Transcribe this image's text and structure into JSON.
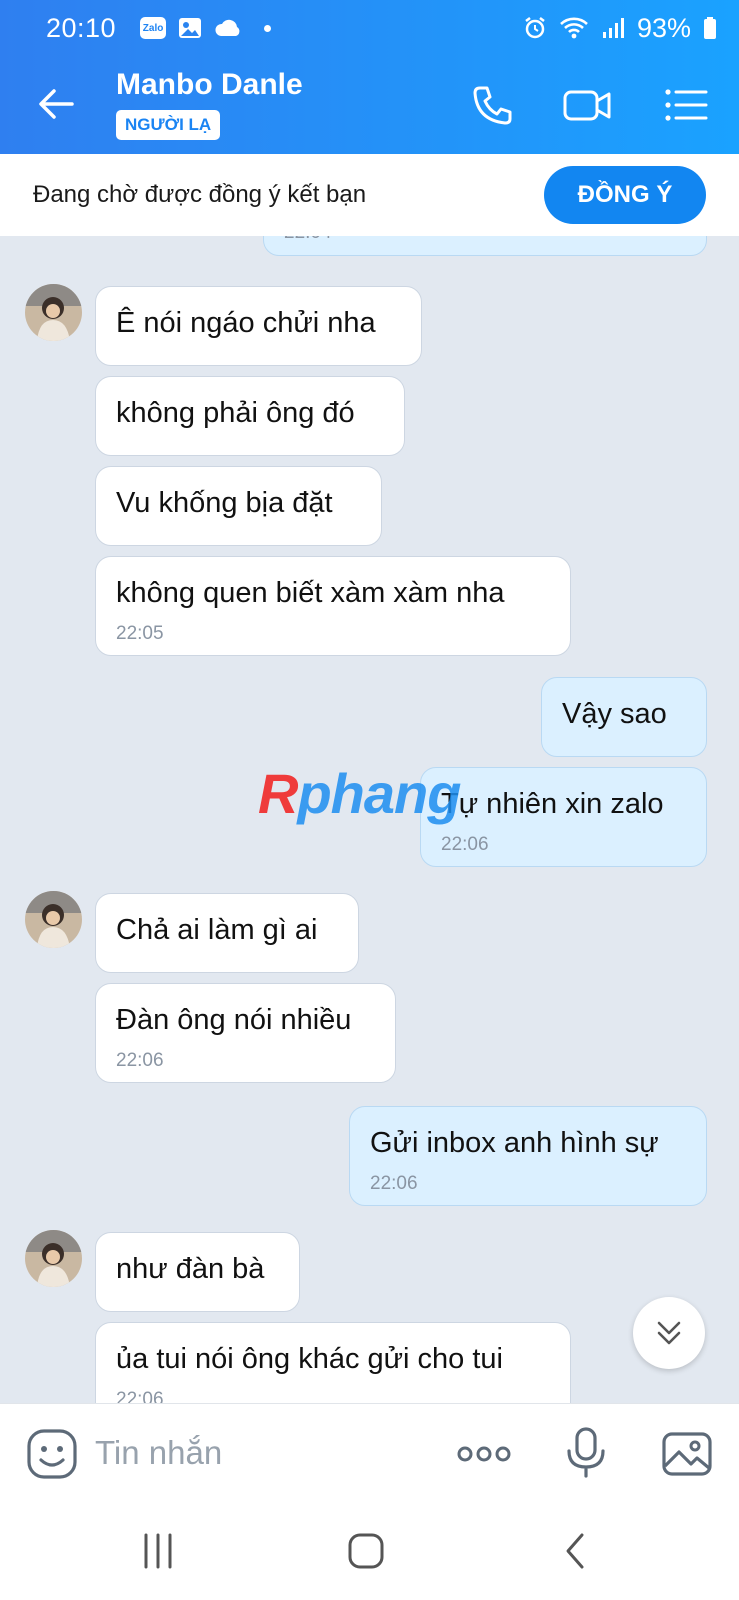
{
  "status_bar": {
    "time": "20:10",
    "zalo_badge": "Zalo",
    "battery": "93%"
  },
  "header": {
    "name": "Manbo Danle",
    "badge": "NGƯỜI LẠ"
  },
  "pending": {
    "text": "Đang chờ được đồng ý kết bạn",
    "accept_label": "ĐỒNG Ý"
  },
  "messages": [
    {
      "dir": "out",
      "text": "",
      "time": "22:04"
    },
    {
      "dir": "in",
      "text": "Ê nói ngáo chửi nha"
    },
    {
      "dir": "in",
      "text": "không phải ông đó"
    },
    {
      "dir": "in",
      "text": "Vu khống bịa đặt"
    },
    {
      "dir": "in",
      "text": "không quen biết xàm xàm nha",
      "time": "22:05"
    },
    {
      "dir": "out",
      "text": "Vậy sao"
    },
    {
      "dir": "out",
      "text": "Tự nhiên xin zalo",
      "time": "22:06"
    },
    {
      "dir": "in",
      "text": "Chả ai làm gì ai"
    },
    {
      "dir": "in",
      "text": "Đàn ông nói nhiều",
      "time": "22:06"
    },
    {
      "dir": "out",
      "text": "Gửi inbox anh hình sự",
      "time": "22:06"
    },
    {
      "dir": "in",
      "text": "như đàn bà"
    },
    {
      "dir": "in",
      "text": "ủa tui nói ông khác gửi cho tui",
      "time": "22:06"
    }
  ],
  "watermark": {
    "first": "R",
    "rest": "phang"
  },
  "composer": {
    "placeholder": "Tin nhắn"
  },
  "icons": {
    "back": "arrow-left-icon",
    "call": "phone-icon",
    "video": "video-camera-icon",
    "menu": "list-menu-icon",
    "sticker": "emoji-icon",
    "more": "more-dots-icon",
    "mic": "microphone-icon",
    "image": "image-icon",
    "scroll": "chevrons-down-icon"
  },
  "colors": {
    "header": "#1f8cf5",
    "accent": "#1286f1",
    "incoming_bubble": "#ffffff",
    "outgoing_bubble": "#dbf0ff",
    "chat_bg": "#e2e8f0"
  }
}
